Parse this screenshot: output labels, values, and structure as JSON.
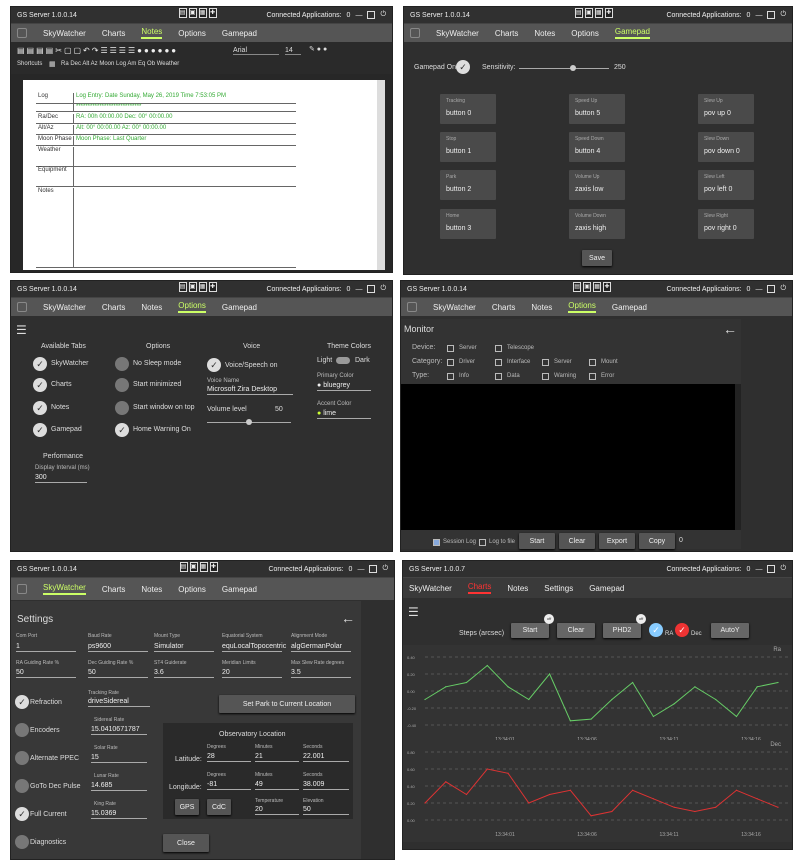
{
  "app_title": "GS Server",
  "versions": [
    "1.0.0.14",
    "1.0.0.14",
    "1.0.0.14",
    "1.0.0.14",
    "1.0.0.14",
    "1.0.0.7"
  ],
  "connected_label": "Connected Applications:",
  "connected_count": "0",
  "nav": {
    "skywatcher": "SkyWatcher",
    "charts": "Charts",
    "notes": "Notes",
    "options": "Options",
    "gamepad": "Gamepad",
    "settings": "Settings"
  },
  "notes": {
    "font": "Arial",
    "size": "14",
    "shortcuts_label": "Shortcuts",
    "shortcut_items": "Ra Dec Alt Az Moon Log Am Eq Ob Weather",
    "rows": [
      {
        "k": "Log",
        "v": "Log Entry: Date Sunday, May 26, 2019 Time 7:53:05 PM"
      },
      {
        "k": "",
        "v": "****************************"
      },
      {
        "k": "Ra/Dec",
        "v": "RA: 00h 00:00.00 Dec: 00° 00:00.00"
      },
      {
        "k": "Alt/Az",
        "v": "Alt: 00° 00:00.00 Az: 00° 00:00.00"
      },
      {
        "k": "Moon Phase",
        "v": "Moon Phase: Last Quarter"
      },
      {
        "k": "Weather",
        "v": ""
      },
      {
        "k": "Equipment",
        "v": ""
      },
      {
        "k": "Notes",
        "v": ""
      }
    ]
  },
  "gamepad": {
    "on_label": "Gamepad On",
    "sens_label": "Sensitivity:",
    "sens_value": "250",
    "sens_level": 0.6,
    "cells": [
      {
        "l": "Tracking",
        "v": "button 0"
      },
      {
        "l": "Speed Up",
        "v": "button 5"
      },
      {
        "l": "Slew Up",
        "v": "pov up 0"
      },
      {
        "l": "Stop",
        "v": "button 1"
      },
      {
        "l": "Speed Down",
        "v": "button 4"
      },
      {
        "l": "Slew Down",
        "v": "pov down 0"
      },
      {
        "l": "Park",
        "v": "button 2"
      },
      {
        "l": "Volume Up",
        "v": "zaxis low"
      },
      {
        "l": "Slew Left",
        "v": "pov left 0"
      },
      {
        "l": "Home",
        "v": "button 3"
      },
      {
        "l": "Volume Down",
        "v": "zaxis high"
      },
      {
        "l": "Slew Right",
        "v": "pov right 0"
      }
    ],
    "save": "Save"
  },
  "options": {
    "avail_title": "Available Tabs",
    "opt_title": "Options",
    "voice_title": "Voice",
    "theme_title": "Theme Colors",
    "tabs": [
      "SkyWatcher",
      "Charts",
      "Notes",
      "Gamepad"
    ],
    "opts": [
      "No Sleep mode",
      "Start minimized",
      "Start window on top",
      "Home Warning On"
    ],
    "voice_on": "Voice/Speech on",
    "voice_name_label": "Voice Name",
    "voice_name": "Microsoft Zira Desktop",
    "volume_label": "Volume level",
    "volume_value": "50",
    "volume_level": 0.5,
    "light": "Light",
    "dark": "Dark",
    "primary_label": "Primary Color",
    "primary": "bluegrey",
    "accent_label": "Accent Color",
    "accent": "lime",
    "perf_title": "Performance",
    "interval_label": "Display Interval (ms)",
    "interval": "300"
  },
  "monitor": {
    "title": "Monitor",
    "device": "Device:",
    "category": "Category:",
    "type": "Type:",
    "dev_opts": [
      "Server",
      "Telescope"
    ],
    "cat_opts": [
      "Driver",
      "Interface",
      "Server",
      "Mount"
    ],
    "type_opts": [
      "Info",
      "Data",
      "Warning",
      "Error"
    ],
    "session_log": "Session Log",
    "log_file": "Log to file",
    "buttons": [
      "Start",
      "Clear",
      "Export",
      "Copy"
    ],
    "count": "0"
  },
  "sw": {
    "title": "Settings",
    "row1": [
      {
        "l": "Com Port",
        "v": "1"
      },
      {
        "l": "Baud Rate",
        "v": "ps9600"
      },
      {
        "l": "Mount Type",
        "v": "Simulator"
      },
      {
        "l": "Equatorial System",
        "v": "equLocalTopocentric"
      },
      {
        "l": "Alignment Mode",
        "v": "algGermanPolar"
      }
    ],
    "row2": [
      {
        "l": "RA Guiding Rate %",
        "v": "50"
      },
      {
        "l": "Dec Guiding Rate %",
        "v": "50"
      },
      {
        "l": "ST4 Guiderate",
        "v": "3.6"
      },
      {
        "l": "Meridian Limits",
        "v": "20"
      },
      {
        "l": "Max Slew Rate degrees",
        "v": "3.5"
      }
    ],
    "checks": [
      "Refraction",
      "Encoders",
      "Alternate PPEC",
      "GoTo Dec Pulse",
      "Full Current",
      "Diagnostics"
    ],
    "tracking_label": "Tracking Rate",
    "tracking": "driveSidereal",
    "rates": [
      {
        "l": "Sidereal Rate",
        "v": "15.0410671787"
      },
      {
        "l": "Solar Rate",
        "v": "15"
      },
      {
        "l": "Lunar Rate",
        "v": "14.685"
      },
      {
        "l": "King Rate",
        "v": "15.0369"
      }
    ],
    "set_park": "Set Park to Current Location",
    "obs_title": "Observatory Location",
    "lat_label": "Latitude:",
    "lon_label": "Longitude:",
    "deg": "Degrees",
    "min": "Minutes",
    "sec": "Seconds",
    "lat": [
      "28",
      "21",
      "22.001"
    ],
    "lon": [
      "-81",
      "49",
      "38.009"
    ],
    "temp_label": "Temperature",
    "temp": "20",
    "elev_label": "Elevation",
    "elev": "50",
    "gps": "GPS",
    "cdc": "CdC",
    "close": "Close"
  },
  "charts": {
    "steps_label": "Steps (arcsec)",
    "start": "Start",
    "clear": "Clear",
    "phd2": "PHD2",
    "ra": "RA",
    "dec": "Dec",
    "autoy": "AutoY",
    "badge": "off"
  },
  "chart_data": [
    {
      "type": "line",
      "title": "Ra",
      "x": [
        "13:34:01",
        "13:34:06",
        "13:34:11",
        "13:34:16"
      ],
      "y_ticks": [
        "0.40",
        "0.20",
        "0.00",
        "-0.20",
        "-0.40"
      ],
      "series": [
        {
          "name": "RA",
          "color": "#6c6",
          "values": [
            -0.1,
            0.05,
            0.1,
            0.3,
            0.05,
            -0.1,
            0.2,
            -0.35,
            -0.33,
            -0.1,
            0.1,
            -0.3,
            -0.15,
            0.05,
            -0.1,
            -0.3,
            0.05,
            0.1
          ]
        }
      ]
    },
    {
      "type": "line",
      "title": "Dec",
      "x": [
        "13:34:01",
        "13:34:06",
        "13:34:11",
        "13:34:16"
      ],
      "y_ticks": [
        "0.80",
        "0.60",
        "0.40",
        "0.20",
        "0.00"
      ],
      "series": [
        {
          "name": "Dec",
          "color": "#d33",
          "values": [
            0.2,
            0.45,
            0.3,
            0.6,
            0.55,
            0.2,
            0.3,
            0.35,
            0.05,
            0.1,
            0.35,
            0.25,
            0.15,
            0.1,
            0.15,
            0.35,
            0.25,
            0.15
          ]
        }
      ]
    }
  ]
}
